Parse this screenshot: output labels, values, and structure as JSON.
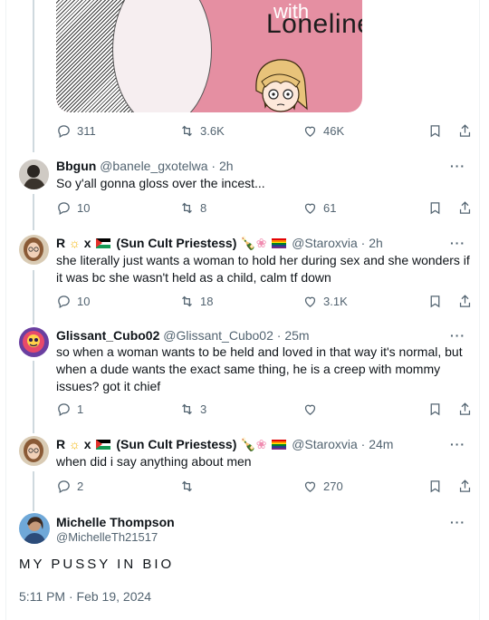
{
  "image_card": {
    "word_top": "with",
    "word_main": "Loneliness"
  },
  "top_post": {
    "stats": {
      "replies": "311",
      "reposts": "3.6K",
      "likes": "46K"
    }
  },
  "replies": [
    {
      "name": "Bbgun",
      "handle": "@banele_gxotelwa",
      "time": "2h",
      "text": "So y'all gonna gloss over the incest...",
      "stats": {
        "replies": "10",
        "reposts": "8",
        "likes": "61"
      }
    },
    {
      "name_prefix": "R",
      "name_x": "x",
      "name_suffix": "(Sun Cult Priestess)",
      "handle": "@Staroxvia",
      "time": "2h",
      "text": "she literally just wants a woman to hold her during sex and she wonders if it was bc she wasn't held as a child, calm tf down",
      "stats": {
        "replies": "10",
        "reposts": "18",
        "likes": "3.1K"
      }
    },
    {
      "name": "Glissant_Cubo02",
      "handle": "@Glissant_Cubo02",
      "time": "25m",
      "text": "so when a woman wants to be held and loved in that way it's normal, but when a dude wants the exact same thing, he is a creep with mommy issues? got it chief",
      "stats": {
        "replies": "1",
        "reposts": "3",
        "likes": ""
      }
    },
    {
      "name_prefix": "R",
      "name_x": "x",
      "name_suffix": "(Sun Cult Priestess)",
      "handle": "@Staroxvia",
      "time": "24m",
      "text": "when did i say anything about men",
      "stats": {
        "replies": "2",
        "reposts": "",
        "likes": "270"
      }
    }
  ],
  "main_post": {
    "name": "Michelle Thompson",
    "handle": "@MichelleTh21517",
    "text": "MY PUSSY IN BIO",
    "timestamp": "5:11 PM · Feb 19, 2024"
  },
  "separator": "·",
  "more_label": "···",
  "icons": [
    "reply-icon",
    "repost-icon",
    "like-icon",
    "bookmark-icon",
    "share-icon",
    "more-icon"
  ],
  "colors": {
    "text": "#0f1419",
    "secondary": "#536471",
    "line": "#cfd9de",
    "card": "#e58fa2"
  }
}
